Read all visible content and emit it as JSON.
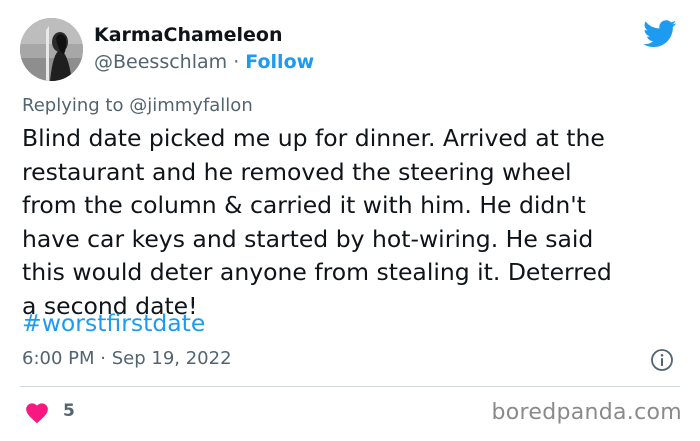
{
  "header": {
    "display_name": "KarmaChameleon",
    "handle": "@Beesschlam",
    "separator": "·",
    "follow_label": "Follow"
  },
  "reply": {
    "prefix": "Replying to",
    "mention": "@jimmyfallon"
  },
  "tweet": {
    "text": "Blind date picked me up for dinner. Arrived at the\nrestaurant and he removed the steering wheel\nfrom the column & carried it with him.  He didn't\nhave car keys and started by hot-wiring.  He said\nthis would deter anyone from stealing it.  Deterred\na second date!",
    "hashtag": "#worstfirstdate"
  },
  "meta": {
    "time": "6:00 PM",
    "separator": "·",
    "date": "Sep 19, 2022"
  },
  "engagement": {
    "likes": "5"
  },
  "watermark": "boredpanda.com",
  "icons": {
    "brand": "twitter-bird-icon",
    "info": "info-icon",
    "like": "heart-icon"
  },
  "colors": {
    "accent": "#1d9bf0",
    "like": "#f91880",
    "secondary_text": "#536471"
  }
}
